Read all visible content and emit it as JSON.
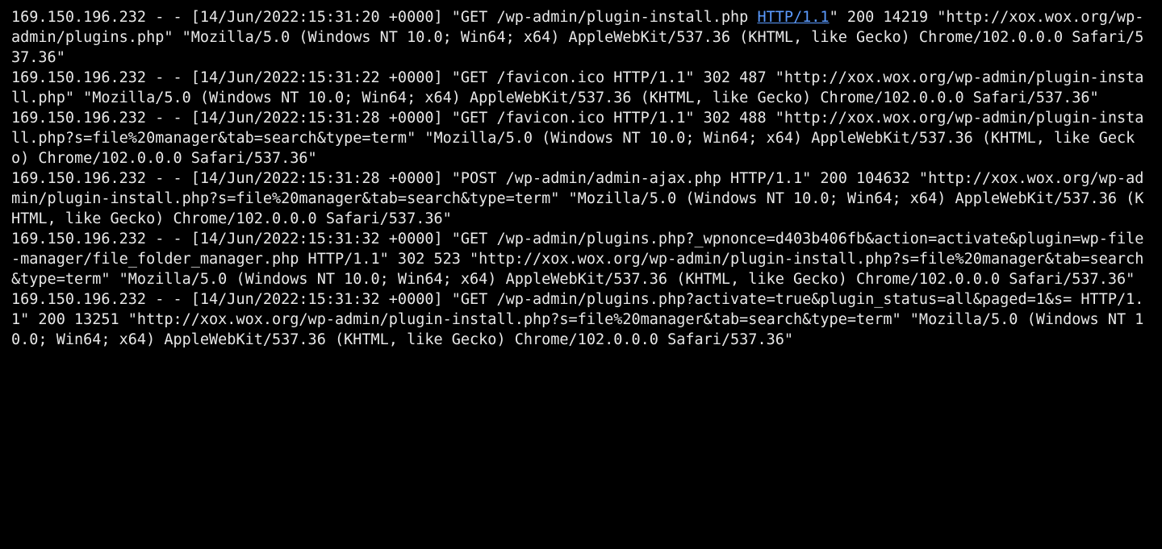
{
  "log": {
    "entries": [
      {
        "pre": "169.150.196.232 - - [14/Jun/2022:15:31:20 +0000] \"GET /wp-admin/plugin-install.php ",
        "link": "HTTP/1.1",
        "post": "\" 200 14219 \"http://xox.wox.org/wp-admin/plugins.php\" \"Mozilla/5.0 (Windows NT 10.0; Win64; x64) AppleWebKit/537.36 (KHTML, like Gecko) Chrome/102.0.0.0 Safari/537.36\""
      },
      {
        "pre": "169.150.196.232 - - [14/Jun/2022:15:31:22 +0000] \"GET /favicon.ico HTTP/1.1\" 302 487 \"http://xox.wox.org/wp-admin/plugin-install.php\" \"Mozilla/5.0 (Windows NT 10.0; Win64; x64) AppleWebKit/537.36 (KHTML, like Gecko) Chrome/102.0.0.0 Safari/537.36\"",
        "link": "",
        "post": ""
      },
      {
        "pre": "169.150.196.232 - - [14/Jun/2022:15:31:28 +0000] \"GET /favicon.ico HTTP/1.1\" 302 488 \"http://xox.wox.org/wp-admin/plugin-install.php?s=file%20manager&tab=search&type=term\" \"Mozilla/5.0 (Windows NT 10.0; Win64; x64) AppleWebKit/537.36 (KHTML, like Gecko) Chrome/102.0.0.0 Safari/537.36\"",
        "link": "",
        "post": ""
      },
      {
        "pre": "169.150.196.232 - - [14/Jun/2022:15:31:28 +0000] \"POST /wp-admin/admin-ajax.php HTTP/1.1\" 200 104632 \"http://xox.wox.org/wp-admin/plugin-install.php?s=file%20manager&tab=search&type=term\" \"Mozilla/5.0 (Windows NT 10.0; Win64; x64) AppleWebKit/537.36 (KHTML, like Gecko) Chrome/102.0.0.0 Safari/537.36\"",
        "link": "",
        "post": ""
      },
      {
        "pre": "169.150.196.232 - - [14/Jun/2022:15:31:32 +0000] \"GET /wp-admin/plugins.php?_wpnonce=d403b406fb&action=activate&plugin=wp-file-manager/file_folder_manager.php HTTP/1.1\" 302 523 \"http://xox.wox.org/wp-admin/plugin-install.php?s=file%20manager&tab=search&type=term\" \"Mozilla/5.0 (Windows NT 10.0; Win64; x64) AppleWebKit/537.36 (KHTML, like Gecko) Chrome/102.0.0.0 Safari/537.36\"",
        "link": "",
        "post": ""
      },
      {
        "pre": "169.150.196.232 - - [14/Jun/2022:15:31:32 +0000] \"GET /wp-admin/plugins.php?activate=true&plugin_status=all&paged=1&s= HTTP/1.1\" 200 13251 \"http://xox.wox.org/wp-admin/plugin-install.php?s=file%20manager&tab=search&type=term\" \"Mozilla/5.0 (Windows NT 10.0; Win64; x64) AppleWebKit/537.36 (KHTML, like Gecko) Chrome/102.0.0.0 Safari/537.36\"",
        "link": "",
        "post": ""
      }
    ]
  }
}
